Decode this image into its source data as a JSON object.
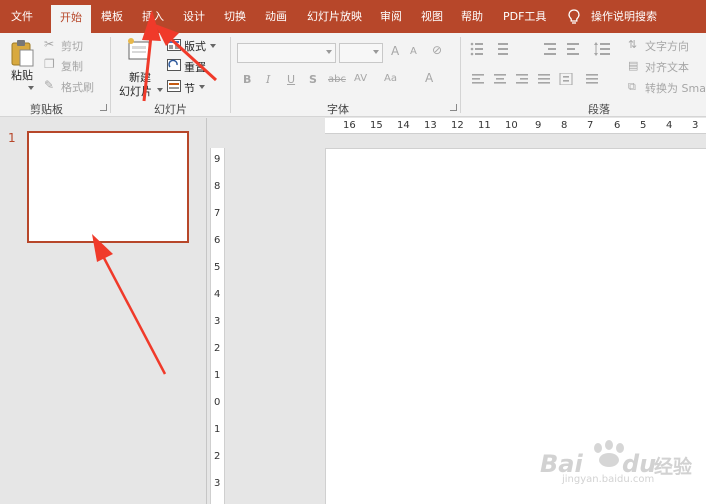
{
  "tabs": [
    "文件",
    "开始",
    "模板",
    "插入",
    "设计",
    "切换",
    "动画",
    "幻灯片放映",
    "审阅",
    "视图",
    "帮助",
    "PDF工具"
  ],
  "active_tab": "开始",
  "tell_me": "操作说明搜索",
  "clipboard": {
    "paste": "粘贴",
    "cut": "剪切",
    "copy": "复制",
    "format_painter": "格式刷",
    "group": "剪贴板"
  },
  "slides_group": {
    "new_slide_line1": "新建",
    "new_slide_line2": "幻灯片",
    "layout": "版式",
    "reset": "重置",
    "section": "节",
    "group": "幻灯片"
  },
  "font_group": {
    "bold": "B",
    "italic": "I",
    "underline": "U",
    "shadow": "S",
    "strikethrough": "abc",
    "spacing": "AV",
    "change_case": "Aa",
    "font_color": "A",
    "grow": "A",
    "shrink": "A",
    "group": "字体"
  },
  "paragraph_group": {
    "text_direction": "文字方向",
    "align_text": "对齐文本",
    "convert_smartart": "转换为 Smar",
    "group": "段落"
  },
  "horizontal_ruler": [
    "16",
    "15",
    "14",
    "13",
    "12",
    "11",
    "10",
    "9",
    "8",
    "7",
    "6",
    "5",
    "4",
    "3"
  ],
  "vertical_ruler": [
    "9",
    "8",
    "7",
    "6",
    "5",
    "4",
    "3",
    "2",
    "1",
    "0",
    "1",
    "2",
    "3"
  ],
  "thumbnail": {
    "number": "1"
  },
  "watermark": {
    "brand": "Bai",
    "brand2": "du",
    "suffix": "经验",
    "url": "jingyan.baidu.com"
  },
  "colors": {
    "brand": "#b7472a",
    "arrow": "#f03a2a"
  }
}
